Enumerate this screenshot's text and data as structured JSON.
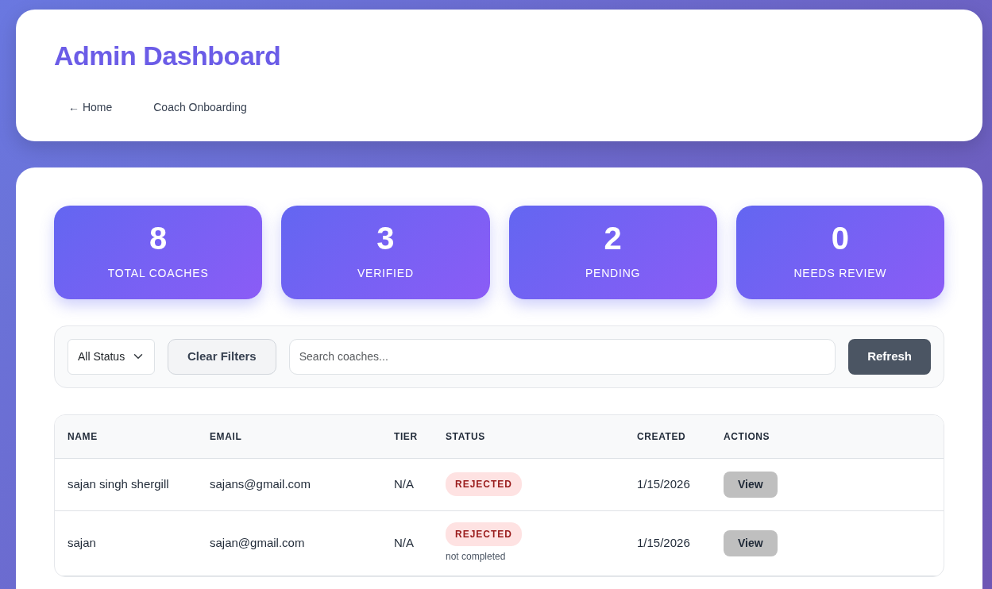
{
  "header": {
    "title": "Admin Dashboard",
    "nav": [
      {
        "label": "← Home"
      },
      {
        "label": "Coach Onboarding"
      }
    ]
  },
  "stats": [
    {
      "value": "8",
      "label": "TOTAL COACHES"
    },
    {
      "value": "3",
      "label": "VERIFIED"
    },
    {
      "value": "2",
      "label": "PENDING"
    },
    {
      "value": "0",
      "label": "NEEDS REVIEW"
    }
  ],
  "filters": {
    "status_select": "All Status",
    "clear_button": "Clear Filters",
    "search": {
      "placeholder": "Search coaches..."
    },
    "refresh_button": "Refresh"
  },
  "table": {
    "columns": [
      "NAME",
      "EMAIL",
      "TIER",
      "STATUS",
      "CREATED",
      "ACTIONS"
    ],
    "rows": [
      {
        "name": "sajan singh shergill",
        "email": "sajans@gmail.com",
        "tier": "N/A",
        "status": {
          "kind": "rejected",
          "label": "REJECTED"
        },
        "created": "1/15/2026",
        "action": "View"
      },
      {
        "name": "sajan",
        "email": "sajan@gmail.com",
        "tier": "N/A",
        "status": {
          "kind": "rejected",
          "label": "REJECTED",
          "note": "not completed"
        },
        "created": "1/15/2026",
        "action": "View"
      }
    ]
  }
}
